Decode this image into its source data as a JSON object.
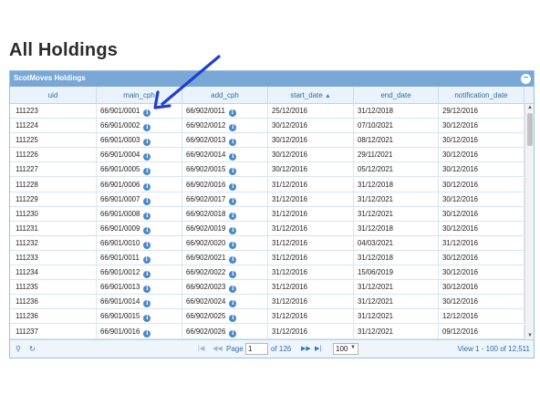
{
  "page": {
    "title": "All Holdings"
  },
  "grid": {
    "caption": "ScotMoves Holdings",
    "collapse_icon": "minus-circle-icon",
    "columns": [
      {
        "key": "uid",
        "label": "uid"
      },
      {
        "key": "main_cph",
        "label": "main_cph"
      },
      {
        "key": "add_cph",
        "label": "add_cph"
      },
      {
        "key": "start_date",
        "label": "start_date",
        "sort_icon": "▲"
      },
      {
        "key": "end_date",
        "label": "end_date"
      },
      {
        "key": "notification_date",
        "label": "notification_date"
      }
    ],
    "rows": [
      {
        "uid": "111223",
        "main_cph": "66/901/0001",
        "add_cph": "66/902/0011",
        "start_date": "25/12/2016",
        "end_date": "31/12/2018",
        "notification_date": "29/12/2016"
      },
      {
        "uid": "111224",
        "main_cph": "66/901/0002",
        "add_cph": "66/902/0012",
        "start_date": "30/12/2016",
        "end_date": "07/10/2021",
        "notification_date": "30/12/2016"
      },
      {
        "uid": "111225",
        "main_cph": "66/901/0003",
        "add_cph": "66/902/0013",
        "start_date": "30/12/2016",
        "end_date": "08/12/2021",
        "notification_date": "30/12/2016"
      },
      {
        "uid": "111226",
        "main_cph": "66/901/0004",
        "add_cph": "66/902/0014",
        "start_date": "30/12/2016",
        "end_date": "29/11/2021",
        "notification_date": "30/12/2016"
      },
      {
        "uid": "111227",
        "main_cph": "66/901/0005",
        "add_cph": "66/902/0015",
        "start_date": "30/12/2016",
        "end_date": "05/12/2021",
        "notification_date": "30/12/2016"
      },
      {
        "uid": "111228",
        "main_cph": "66/901/0006",
        "add_cph": "66/902/0016",
        "start_date": "31/12/2016",
        "end_date": "31/12/2018",
        "notification_date": "30/12/2016"
      },
      {
        "uid": "111229",
        "main_cph": "66/901/0007",
        "add_cph": "66/902/0017",
        "start_date": "31/12/2016",
        "end_date": "31/12/2021",
        "notification_date": "30/12/2016"
      },
      {
        "uid": "111230",
        "main_cph": "66/901/0008",
        "add_cph": "66/902/0018",
        "start_date": "31/12/2016",
        "end_date": "31/12/2021",
        "notification_date": "30/12/2016"
      },
      {
        "uid": "111231",
        "main_cph": "66/901/0009",
        "add_cph": "66/902/0019",
        "start_date": "31/12/2016",
        "end_date": "31/12/2018",
        "notification_date": "30/12/2016"
      },
      {
        "uid": "111232",
        "main_cph": "66/901/0010",
        "add_cph": "66/902/0020",
        "start_date": "31/12/2016",
        "end_date": "04/03/2021",
        "notification_date": "31/12/2016"
      },
      {
        "uid": "111233",
        "main_cph": "66/901/0011",
        "add_cph": "66/902/0021",
        "start_date": "31/12/2016",
        "end_date": "31/12/2018",
        "notification_date": "30/12/2016"
      },
      {
        "uid": "111234",
        "main_cph": "66/901/0012",
        "add_cph": "66/902/0022",
        "start_date": "31/12/2016",
        "end_date": "15/06/2019",
        "notification_date": "30/12/2016"
      },
      {
        "uid": "111235",
        "main_cph": "66/901/0013",
        "add_cph": "66/902/0023",
        "start_date": "31/12/2016",
        "end_date": "31/12/2021",
        "notification_date": "30/12/2016"
      },
      {
        "uid": "111236",
        "main_cph": "66/901/0014",
        "add_cph": "66/902/0024",
        "start_date": "31/12/2016",
        "end_date": "31/12/2021",
        "notification_date": "30/12/2016"
      },
      {
        "uid": "111236",
        "main_cph": "66/901/0015",
        "add_cph": "66/902/0025",
        "start_date": "31/12/2016",
        "end_date": "31/12/2021",
        "notification_date": "12/12/2016"
      },
      {
        "uid": "111237",
        "main_cph": "66/901/0016",
        "add_cph": "66/902/0026",
        "start_date": "31/12/2016",
        "end_date": "31/12/2021",
        "notification_date": "09/12/2016"
      }
    ],
    "info_icon": "info-icon"
  },
  "pager": {
    "search_icon": "search-icon",
    "refresh_icon": "refresh-icon",
    "first_icon": "first-page-icon",
    "prev_icon": "prev-page-icon",
    "next_icon": "next-page-icon",
    "last_icon": "last-page-icon",
    "page_label": "Page",
    "page_value": "1",
    "of_label": "of 126",
    "rows_per_page": "100",
    "view_text": "View 1 - 100 of 12,511"
  },
  "annotation": {
    "arrow_color": "#1f3fd1"
  }
}
